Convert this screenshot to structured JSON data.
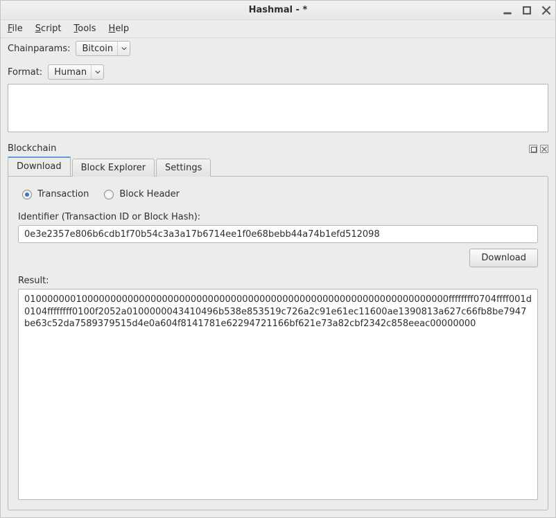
{
  "window": {
    "title": "Hashmal -  *"
  },
  "menu": {
    "file": "File",
    "script": "Script",
    "tools": "Tools",
    "help": "Help"
  },
  "chainparams": {
    "label": "Chainparams:",
    "selected": "Bitcoin"
  },
  "format": {
    "label": "Format:",
    "selected": "Human"
  },
  "panel": {
    "title": "Blockchain"
  },
  "tabs": {
    "download": "Download",
    "explorer": "Block Explorer",
    "settings": "Settings"
  },
  "download": {
    "radio_tx": "Transaction",
    "radio_block": "Block Header",
    "id_label": "Identifier (Transaction ID or Block Hash):",
    "id_value": "0e3e2357e806b6cdb1f70b54c3a3a17b6714ee1f0e68bebb44a74b1efd512098",
    "button": "Download",
    "result_label": "Result:",
    "result_value": "01000000010000000000000000000000000000000000000000000000000000000000000000ffffffff0704ffff001d0104ffffffff0100f2052a0100000043410496b538e853519c726a2c91e61ec11600ae1390813a627c66fb8be7947be63c52da7589379515d4e0a604f8141781e62294721166bf621e73a82cbf2342c858eeac00000000"
  }
}
